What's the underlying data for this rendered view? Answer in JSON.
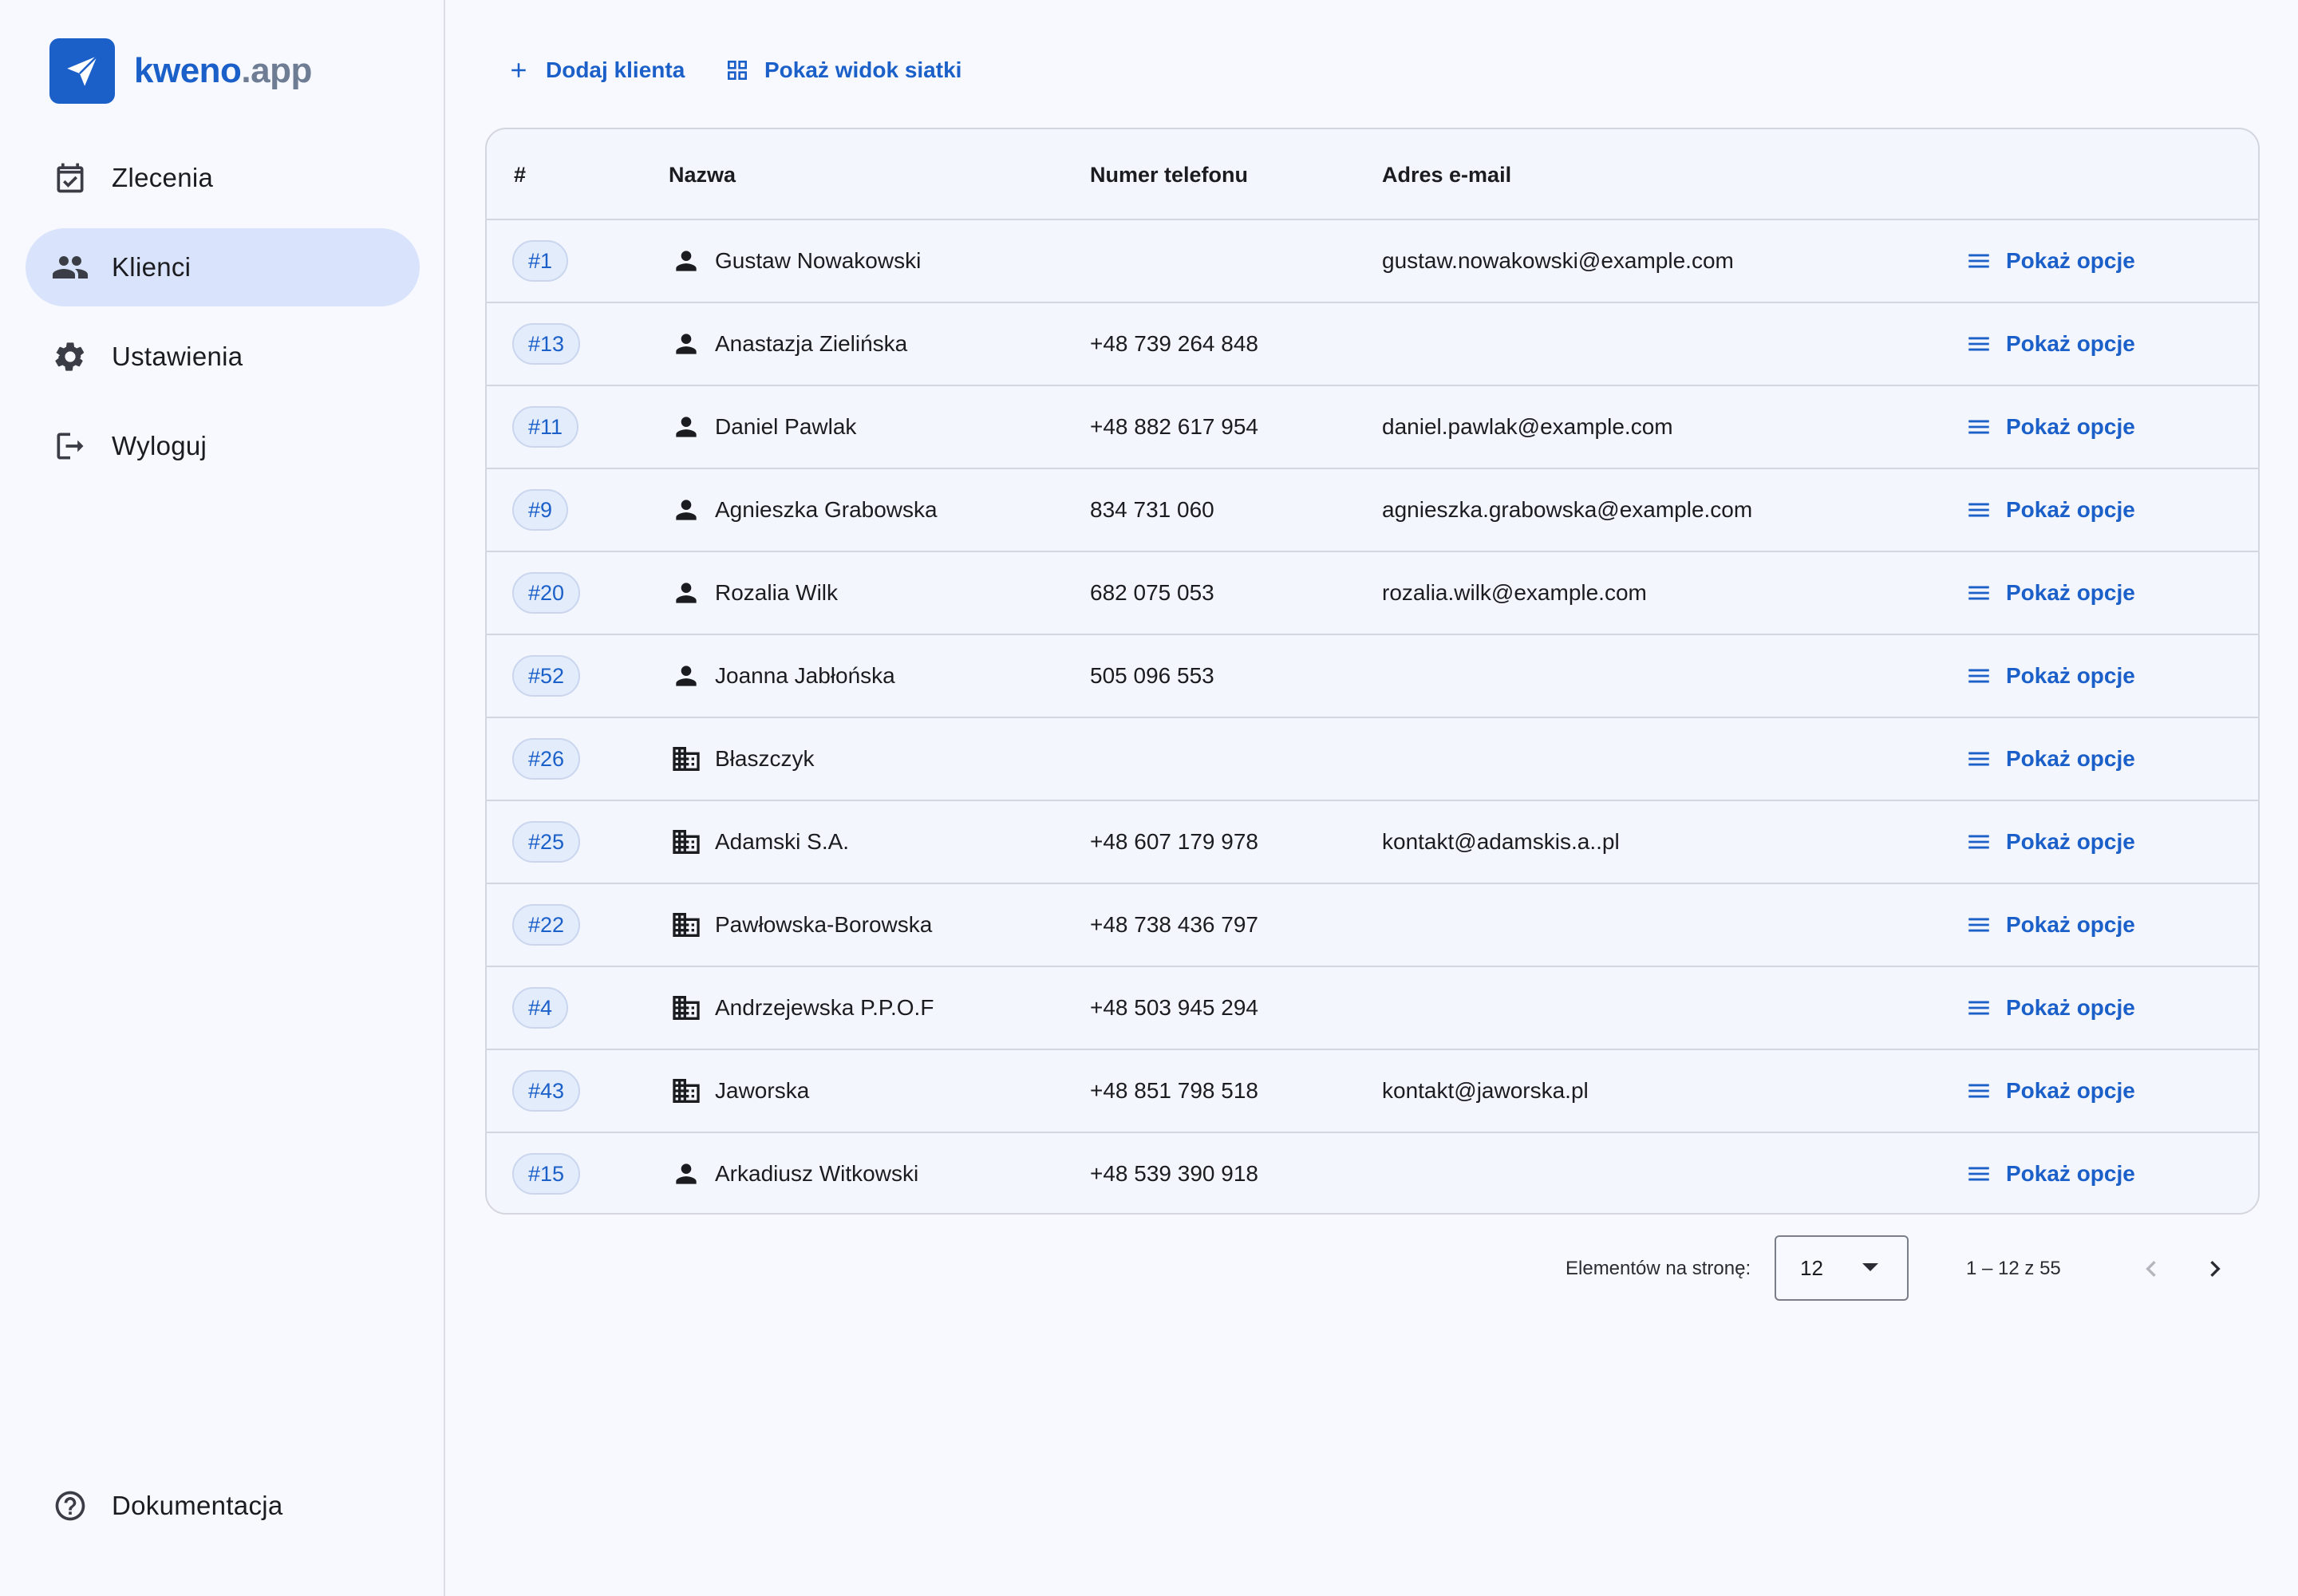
{
  "brand": {
    "name_part1": "kweno",
    "name_part2": ".app"
  },
  "sidebar": {
    "items": [
      {
        "label": "Zlecenia",
        "icon": "calendar-check-icon",
        "active": false
      },
      {
        "label": "Klienci",
        "icon": "people-icon",
        "active": true
      },
      {
        "label": "Ustawienia",
        "icon": "gear-icon",
        "active": false
      },
      {
        "label": "Wyloguj",
        "icon": "logout-icon",
        "active": false
      }
    ],
    "footer_item": {
      "label": "Dokumentacja",
      "icon": "help-circle-icon"
    }
  },
  "toolbar": {
    "add_label": "Dodaj klienta",
    "grid_label": "Pokaż widok siatki"
  },
  "table": {
    "headers": {
      "id": "#",
      "name": "Nazwa",
      "phone": "Numer telefonu",
      "email": "Adres e-mail"
    },
    "options_label": "Pokaż opcje",
    "rows": [
      {
        "id": "#1",
        "type": "person",
        "name": "Gustaw Nowakowski",
        "phone": "",
        "email": "gustaw.nowakowski@example.com"
      },
      {
        "id": "#13",
        "type": "person",
        "name": "Anastazja Zielińska",
        "phone": "+48 739 264 848",
        "email": ""
      },
      {
        "id": "#11",
        "type": "person",
        "name": "Daniel Pawlak",
        "phone": "+48 882 617 954",
        "email": "daniel.pawlak@example.com"
      },
      {
        "id": "#9",
        "type": "person",
        "name": "Agnieszka Grabowska",
        "phone": "834 731 060",
        "email": "agnieszka.grabowska@example.com"
      },
      {
        "id": "#20",
        "type": "person",
        "name": "Rozalia Wilk",
        "phone": "682 075 053",
        "email": "rozalia.wilk@example.com"
      },
      {
        "id": "#52",
        "type": "person",
        "name": "Joanna Jabłońska",
        "phone": "505 096 553",
        "email": ""
      },
      {
        "id": "#26",
        "type": "company",
        "name": "Błaszczyk",
        "phone": "",
        "email": ""
      },
      {
        "id": "#25",
        "type": "company",
        "name": "Adamski S.A.",
        "phone": "+48 607 179 978",
        "email": "kontakt@adamskis.a..pl"
      },
      {
        "id": "#22",
        "type": "company",
        "name": "Pawłowska-Borowska",
        "phone": "+48 738 436 797",
        "email": ""
      },
      {
        "id": "#4",
        "type": "company",
        "name": "Andrzejewska P.P.O.F",
        "phone": "+48 503 945 294",
        "email": ""
      },
      {
        "id": "#43",
        "type": "company",
        "name": "Jaworska",
        "phone": "+48 851 798 518",
        "email": "kontakt@jaworska.pl"
      },
      {
        "id": "#15",
        "type": "person",
        "name": "Arkadiusz Witkowski",
        "phone": "+48 539 390 918",
        "email": ""
      }
    ]
  },
  "pagination": {
    "per_page_label": "Elementów na stronę:",
    "per_page_value": "12",
    "range_text": "1 – 12 z 55"
  },
  "colors": {
    "accent": "#1b5fc9",
    "active_nav_bg": "#d9e3fb",
    "chip_bg": "#e3ecfb"
  }
}
